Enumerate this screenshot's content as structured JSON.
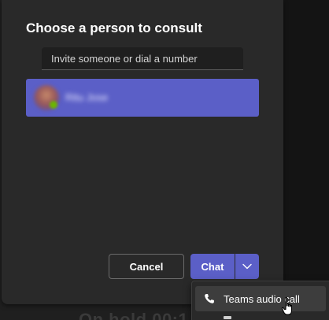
{
  "background": {
    "status_text": "On hold  00:1"
  },
  "dialog": {
    "title": "Choose a person to consult",
    "search": {
      "placeholder": "Invite someone or dial a number",
      "value": ""
    },
    "selected_person": {
      "name": "Ritu Jose",
      "avatar_icon": "avatar-icon",
      "status": "available"
    },
    "actions": {
      "cancel_label": "Cancel",
      "chat_label": "Chat",
      "dropdown_icon": "chevron-down-icon"
    }
  },
  "menu": {
    "items": [
      {
        "label": "Teams audio call",
        "icon": "phone-icon"
      }
    ]
  },
  "colors": {
    "accent": "#5b5fc7",
    "dialog_bg": "#292929",
    "page_bg": "#1f1f1f",
    "menu_hover": "#3d3d3d",
    "presence_available": "#6bb700"
  }
}
